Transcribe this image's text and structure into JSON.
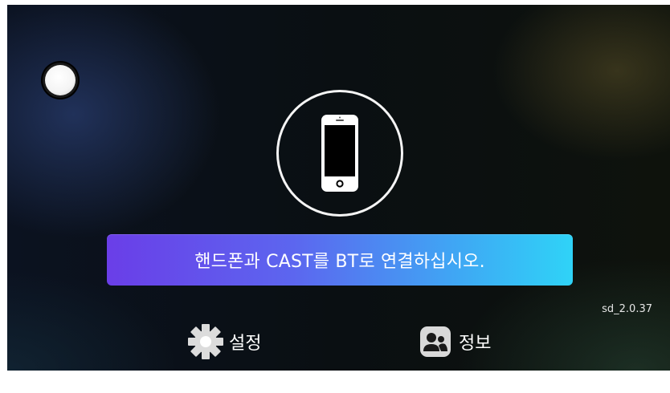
{
  "banner": {
    "text": "핸드폰과 CAST를 BT로 연결하십시오."
  },
  "version": {
    "text": "sd_2.0.37"
  },
  "menu": {
    "settings_label": "설정",
    "info_label": "정보"
  },
  "icons": {
    "float": "circle-button-icon",
    "phone": "smartphone-icon",
    "settings": "gear-icon",
    "info": "contacts-icon"
  },
  "colors": {
    "banner_start": "#6a3ee8",
    "banner_end": "#2fd3f7",
    "text": "#ffffff"
  }
}
